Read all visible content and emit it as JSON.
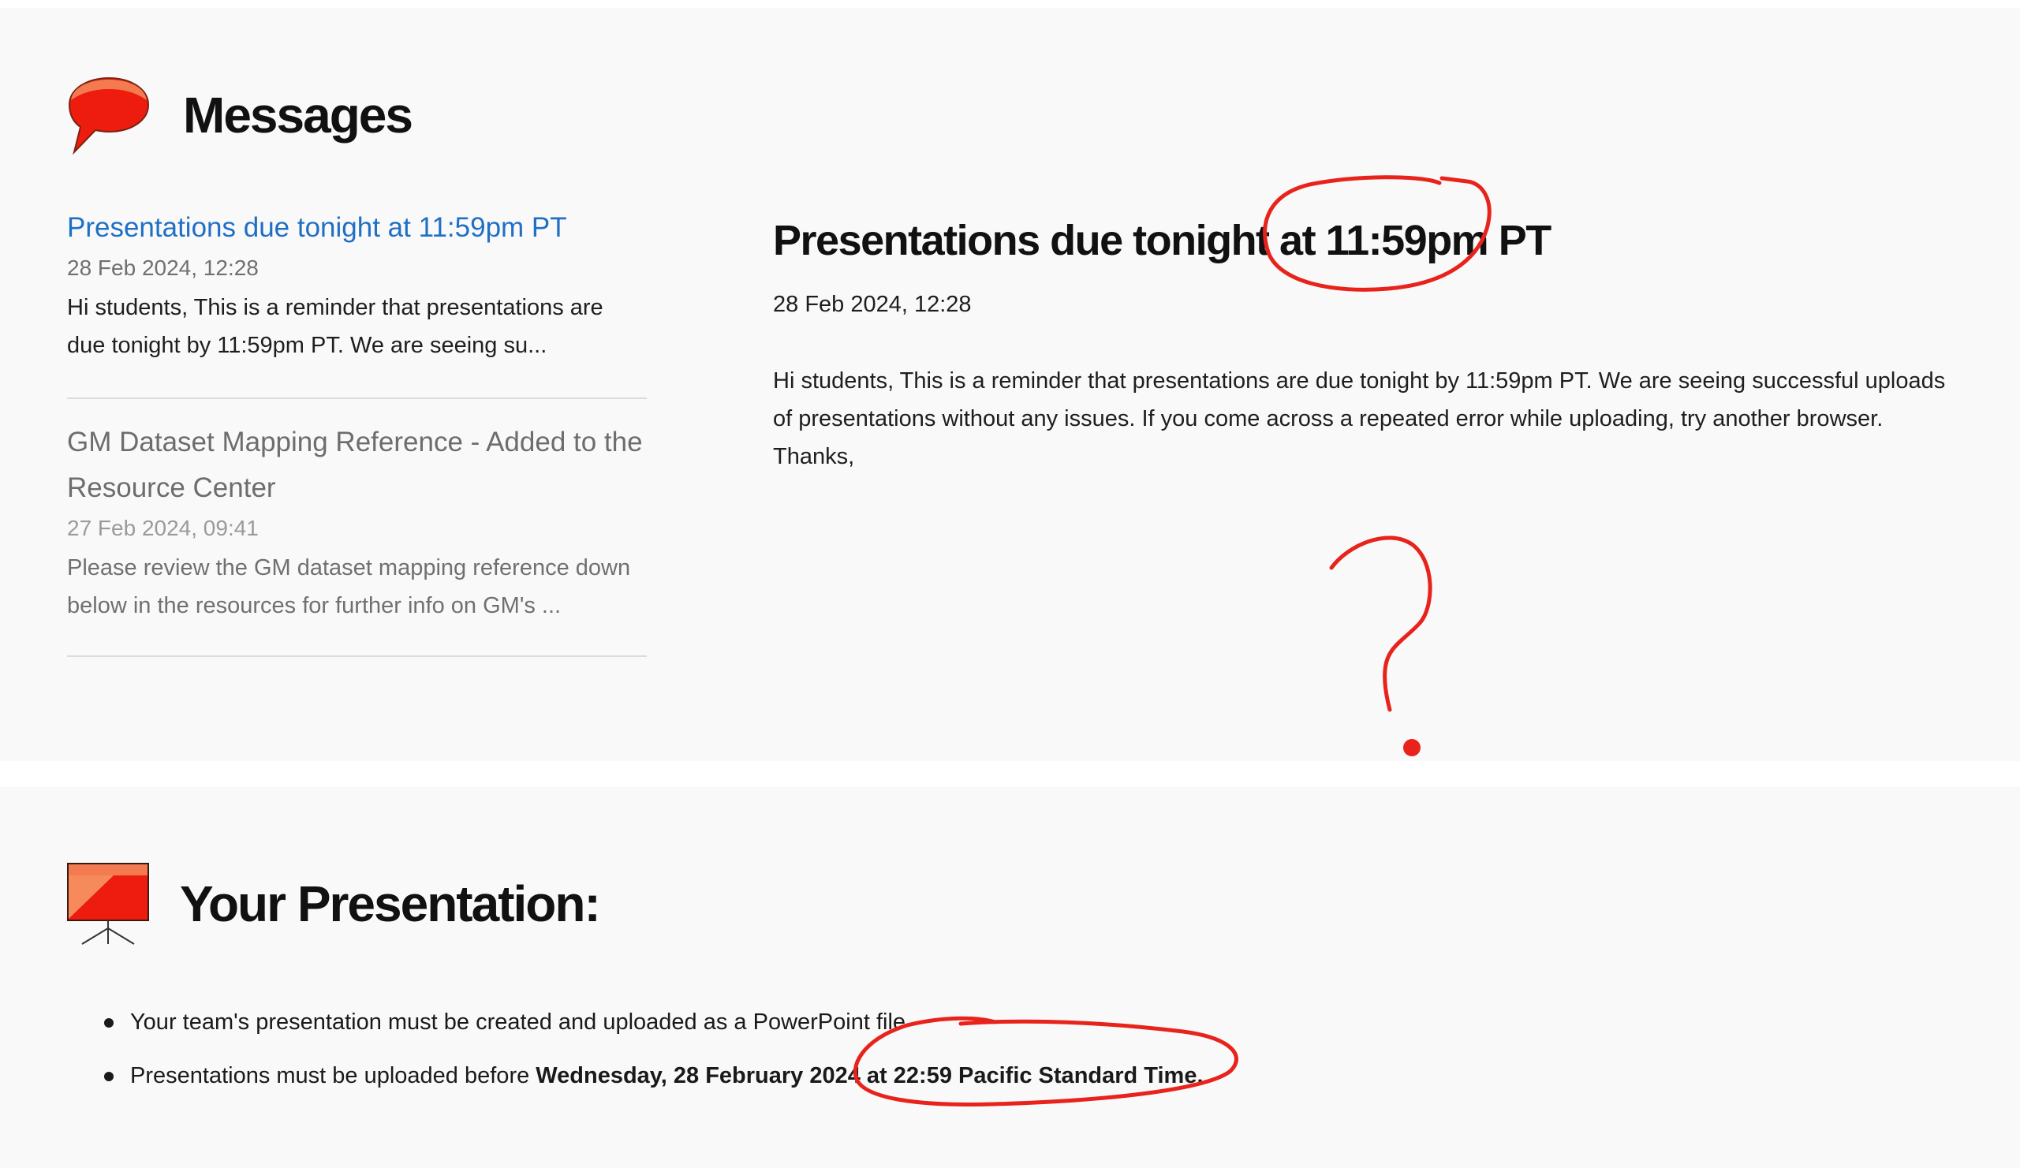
{
  "messages_section": {
    "title": "Messages",
    "icon": "speech-bubble-icon",
    "list": [
      {
        "title": "Presentations due tonight at 11:59pm PT",
        "date": "28 Feb 2024, 12:28",
        "snippet": "Hi students, This is a reminder that presentations are due tonight by 11:59pm PT. We are seeing su..."
      },
      {
        "title": "GM Dataset Mapping Reference - Added to the Resource Center",
        "date": "27 Feb 2024, 09:41",
        "snippet": "Please review the GM dataset mapping reference down below in the resources for further info on GM's ..."
      }
    ],
    "detail": {
      "title": "Presentations due tonight at 11:59pm PT",
      "date": "28 Feb 2024, 12:28",
      "body": "Hi students, This is a reminder that presentations are due tonight by 11:59pm PT. We are seeing successful uploads of presentations without any issues. If you come across a repeated error while uploading, try another browser. Thanks,"
    }
  },
  "presentation_section": {
    "title": "Your Presentation:",
    "icon": "presentation-board-icon",
    "bullets": [
      {
        "text": "Your team's presentation must be created and uploaded as a PowerPoint file"
      },
      {
        "prefix": "Presentations must be uploaded before ",
        "bold": "Wednesday, 28 February 2024 at 22:59 Pacific Standard Time."
      }
    ]
  },
  "colors": {
    "accent_link": "#1f6fc5",
    "annotation_red": "#e8231b",
    "panel_bg": "#f9f9f9"
  }
}
